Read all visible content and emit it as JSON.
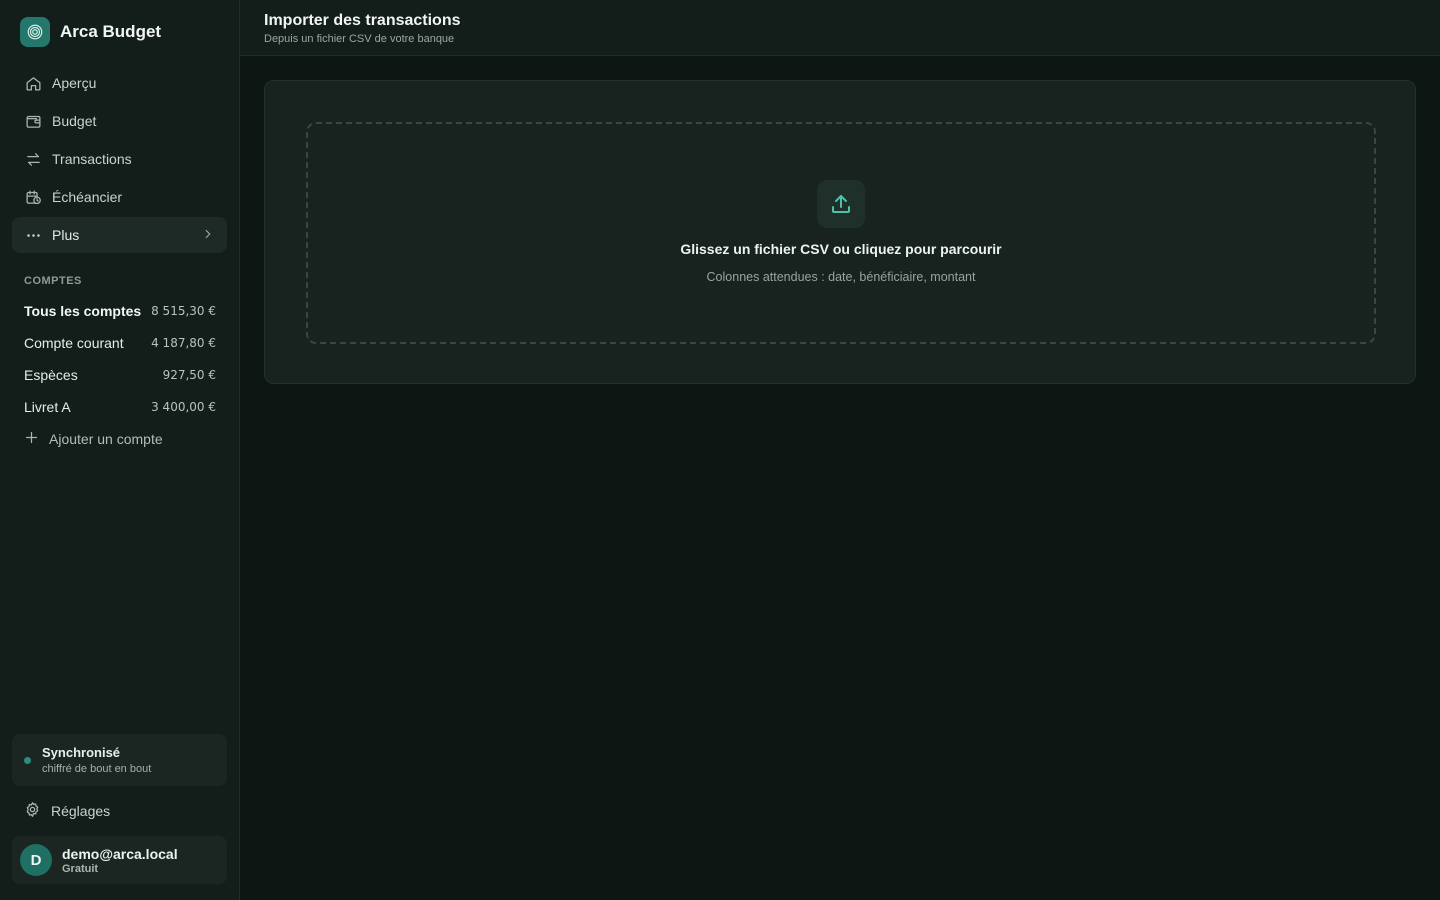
{
  "app": {
    "name": "Arca Budget"
  },
  "nav": {
    "items": [
      {
        "label": "Aperçu",
        "icon": "home-icon"
      },
      {
        "label": "Budget",
        "icon": "wallet-icon"
      },
      {
        "label": "Transactions",
        "icon": "arrows-swap-icon"
      },
      {
        "label": "Échéancier",
        "icon": "calendar-clock-icon"
      },
      {
        "label": "Plus",
        "icon": "more-dots-icon"
      }
    ]
  },
  "accounts": {
    "section_title": "COMPTES",
    "items": [
      {
        "name": "Tous les comptes",
        "amount": "8 515,30 €"
      },
      {
        "name": "Compte courant",
        "amount": "4 187,80 €"
      },
      {
        "name": "Espèces",
        "amount": "927,50 €"
      },
      {
        "name": "Livret A",
        "amount": "3 400,00 €"
      }
    ],
    "add_label": "Ajouter un compte"
  },
  "sync": {
    "title": "Synchronisé",
    "subtitle": "chiffré de bout en bout"
  },
  "settings": {
    "label": "Réglages"
  },
  "user": {
    "initial": "D",
    "email": "demo@arca.local",
    "plan": "Gratuit"
  },
  "header": {
    "title": "Importer des transactions",
    "subtitle": "Depuis un fichier CSV de votre banque"
  },
  "dropzone": {
    "title": "Glissez un fichier CSV ou cliquez pour parcourir",
    "subtitle": "Colonnes attendues : date, bénéficiaire, montant"
  },
  "colors": {
    "accent": "#24776a",
    "icon_accent": "#4cc2a8",
    "background": "#0d1613",
    "sidebar": "#131d1a"
  }
}
